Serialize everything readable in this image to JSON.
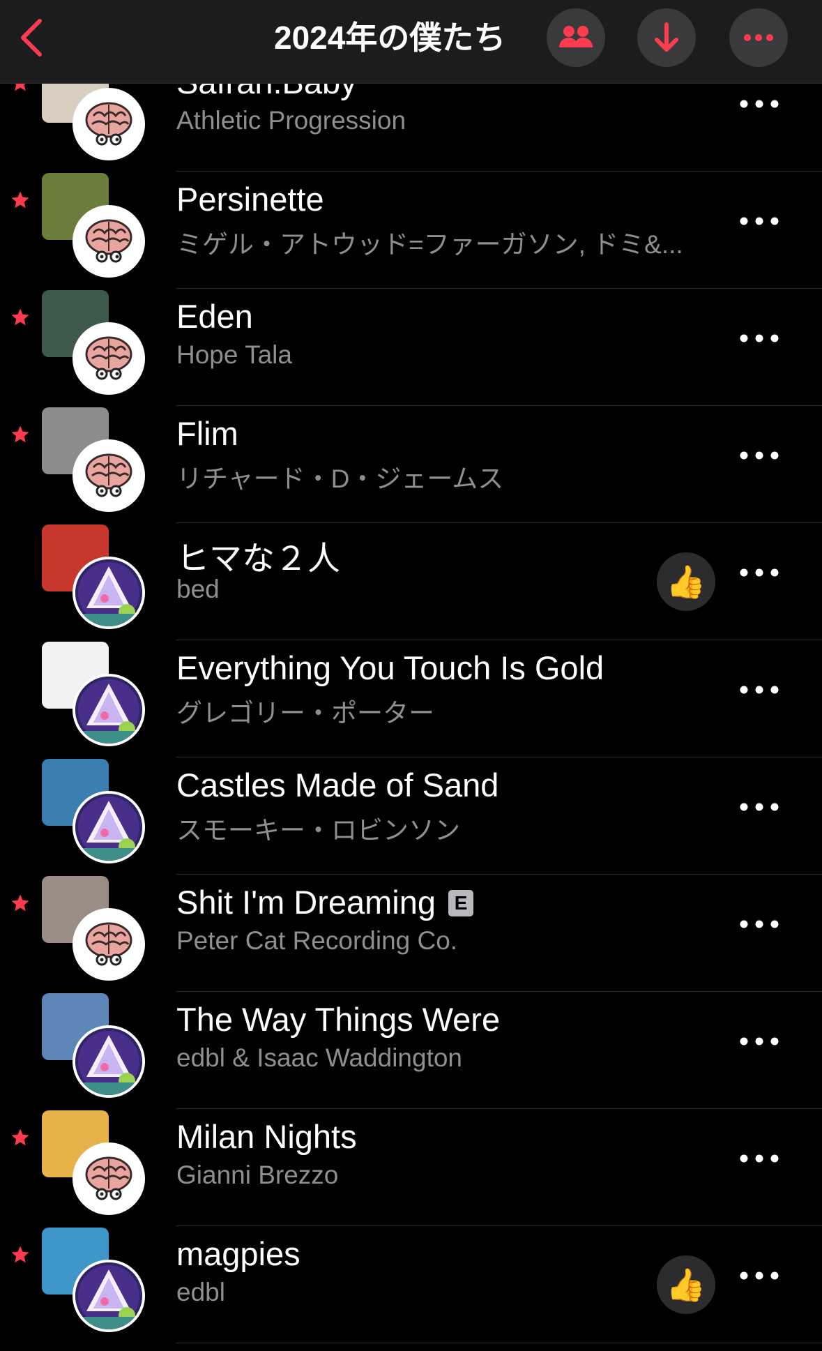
{
  "header": {
    "title": "2024年の僕たち",
    "accent": "#fe3c4f"
  },
  "songs": [
    {
      "title": "Safran.Baby",
      "artist": "Athletic Progression",
      "starred": true,
      "avatar": "brain",
      "thumb": false,
      "explicit": false
    },
    {
      "title": "Persinette",
      "artist": "ミゲル・アトウッド=ファーガソン, ドミ&...",
      "starred": true,
      "avatar": "brain",
      "thumb": false,
      "explicit": false
    },
    {
      "title": "Eden",
      "artist": "Hope Tala",
      "starred": true,
      "avatar": "brain",
      "thumb": false,
      "explicit": false
    },
    {
      "title": "Flim",
      "artist": "リチャード・D・ジェームス",
      "starred": true,
      "avatar": "brain",
      "thumb": false,
      "explicit": false
    },
    {
      "title": "ヒマな２人",
      "artist": "bed",
      "starred": false,
      "avatar": "pyramid",
      "thumb": true,
      "explicit": false
    },
    {
      "title": "Everything You Touch Is Gold",
      "artist": "グレゴリー・ポーター",
      "starred": false,
      "avatar": "pyramid",
      "thumb": false,
      "explicit": false
    },
    {
      "title": "Castles Made of Sand",
      "artist": "スモーキー・ロビンソン",
      "starred": false,
      "avatar": "pyramid",
      "thumb": false,
      "explicit": false
    },
    {
      "title": "Shit I'm Dreaming",
      "artist": "Peter Cat Recording Co.",
      "starred": true,
      "avatar": "brain",
      "thumb": false,
      "explicit": true
    },
    {
      "title": "The Way Things Were",
      "artist": "edbl & Isaac Waddington",
      "starred": false,
      "avatar": "pyramid",
      "thumb": false,
      "explicit": false
    },
    {
      "title": "Milan Nights",
      "artist": "Gianni Brezzo",
      "starred": true,
      "avatar": "brain",
      "thumb": false,
      "explicit": false
    },
    {
      "title": "magpies",
      "artist": "edbl",
      "starred": true,
      "avatar": "pyramid",
      "thumb": true,
      "explicit": false
    }
  ],
  "explicit_badge": "E",
  "thumb_glyph": "👍",
  "art_icons": [
    "album-art-car",
    "album-art-collage",
    "album-art-green-painting",
    "album-art-bw-photo",
    "album-art-bed",
    "album-art-all-rise",
    "album-art-castles",
    "album-art-street-photo",
    "album-art-portrait-blue",
    "album-art-gianni-brezzo",
    "album-art-magpies"
  ],
  "art_colors": [
    "#d9cfc0",
    "#6a7d3c",
    "#3f5a4b",
    "#8c8c8c",
    "#c8372d",
    "#f2f2f2",
    "#3a7fb0",
    "#9a8d86",
    "#5e87b8",
    "#e6b34a",
    "#3f97c9"
  ]
}
